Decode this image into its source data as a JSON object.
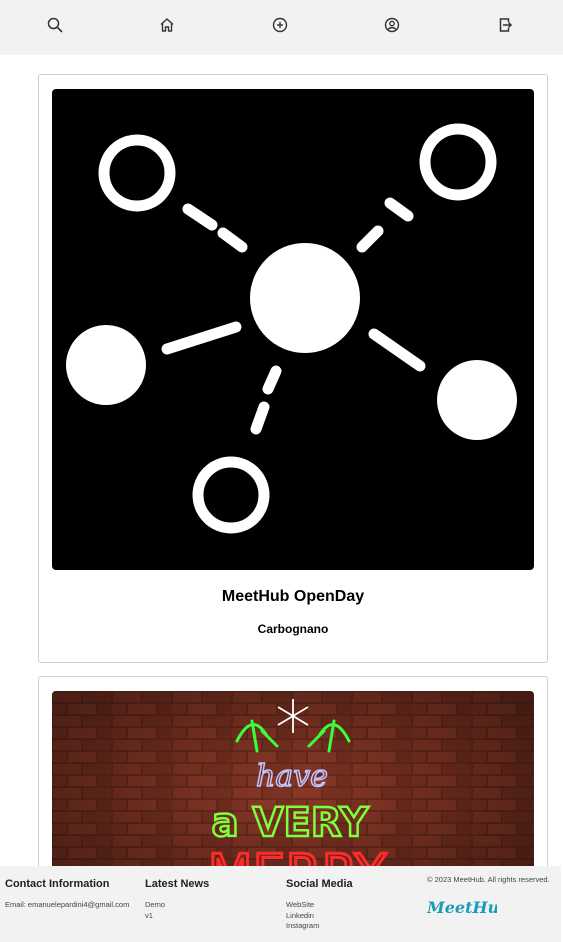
{
  "nav": {
    "items": [
      {
        "icon": "search-icon"
      },
      {
        "icon": "home-icon"
      },
      {
        "icon": "add-circle-icon"
      },
      {
        "icon": "user-icon"
      },
      {
        "icon": "logout-icon"
      }
    ]
  },
  "events": [
    {
      "title": "MeetHub OpenDay",
      "location": "Carbognano",
      "image": "network-graph-image"
    },
    {
      "title": "",
      "location": "",
      "image": "neon-merry-christmas-image",
      "image_text": [
        "have",
        "a VERY",
        "MERRY"
      ]
    }
  ],
  "footer": {
    "contact": {
      "heading": "Contact Information",
      "email": "Email: emanuelepardini4@gmail.com"
    },
    "news": {
      "heading": "Latest News",
      "items": [
        "Demo",
        "v1"
      ]
    },
    "social": {
      "heading": "Social Media",
      "items": [
        "WebSite",
        "Linkedin",
        "Instagram"
      ]
    },
    "copyright": "© 2023 MeetHub. All rights reserved.",
    "logo_text": "MeetHub",
    "logo_color": "#1a9bb8"
  }
}
